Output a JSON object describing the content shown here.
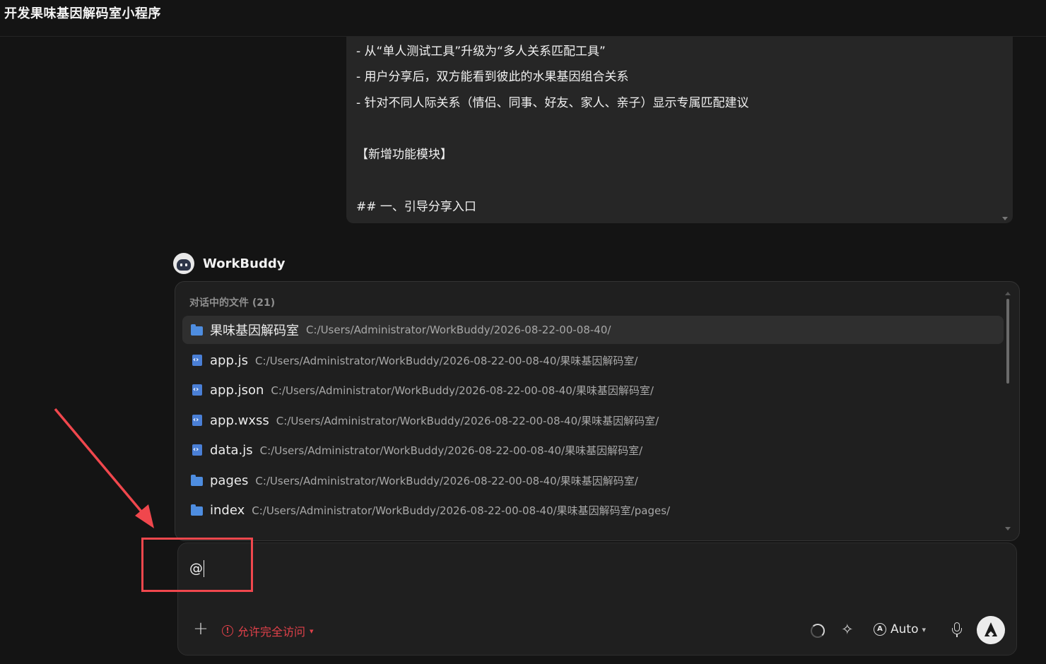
{
  "window": {
    "title": "开发果味基因解码室小程序"
  },
  "message": {
    "lines": [
      "- 从“单人测试工具”升级为“多人关系匹配工具”",
      "- 用户分享后，双方能看到彼此的水果基因组合关系",
      "- 针对不同人际关系（情侣、同事、好友、家人、亲子）显示专属匹配建议",
      "【新增功能模块】",
      "## 一、引导分享入口"
    ]
  },
  "assistant": {
    "name": "WorkBuddy"
  },
  "file_picker": {
    "header": "对话中的文件 (21)",
    "items": [
      {
        "type": "folder",
        "name": "果味基因解码室",
        "path": "C:/Users/Administrator/WorkBuddy/2026-08-22-00-08-40/"
      },
      {
        "type": "file",
        "name": "app.js",
        "path": "C:/Users/Administrator/WorkBuddy/2026-08-22-00-08-40/果味基因解码室/"
      },
      {
        "type": "file",
        "name": "app.json",
        "path": "C:/Users/Administrator/WorkBuddy/2026-08-22-00-08-40/果味基因解码室/"
      },
      {
        "type": "file",
        "name": "app.wxss",
        "path": "C:/Users/Administrator/WorkBuddy/2026-08-22-00-08-40/果味基因解码室/"
      },
      {
        "type": "file",
        "name": "data.js",
        "path": "C:/Users/Administrator/WorkBuddy/2026-08-22-00-08-40/果味基因解码室/"
      },
      {
        "type": "folder",
        "name": "pages",
        "path": "C:/Users/Administrator/WorkBuddy/2026-08-22-00-08-40/果味基因解码室/"
      },
      {
        "type": "folder",
        "name": "index",
        "path": "C:/Users/Administrator/WorkBuddy/2026-08-22-00-08-40/果味基因解码室/pages/"
      }
    ]
  },
  "input": {
    "value": "@",
    "access_label": "允许完全访问",
    "model_label": "Auto"
  },
  "icons": {
    "plus": "plus-icon",
    "warning": "warning-icon",
    "spinner": "loading-spinner-icon",
    "sparkle": "sparkle-icon",
    "auto": "auto-mode-icon",
    "mic": "microphone-icon",
    "send": "send-arrow-icon"
  },
  "colors": {
    "background": "#141414",
    "panel": "#1f1f1f",
    "active_row": "#2f2f2f",
    "warning_red": "#e0414a",
    "annotation_red": "#f0474d",
    "folder_blue": "#4e8de0"
  }
}
